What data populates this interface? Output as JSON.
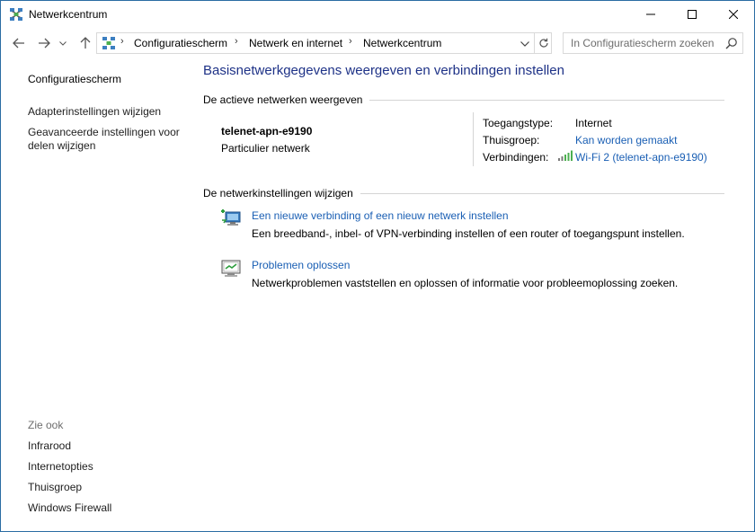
{
  "window": {
    "title": "Netwerkcentrum",
    "accent": "#2b6ca3"
  },
  "navigation": {
    "breadcrumbs": [
      "Configuratiescherm",
      "Netwerk en internet",
      "Netwerkcentrum"
    ],
    "search_placeholder": "In Configuratiescherm zoeken"
  },
  "sidebar": {
    "home": "Configuratiescherm",
    "links": [
      "Adapterinstellingen wijzigen",
      "Geavanceerde instellingen voor",
      "delen wijzigen"
    ],
    "see_also_heading": "Zie ook",
    "see_also": [
      "Infrarood",
      "Internetopties",
      "Thuisgroep",
      "Windows Firewall"
    ]
  },
  "main": {
    "title": "Basisnetwerkgegevens weergeven en verbindingen instellen",
    "active_networks_heading": "De actieve netwerken weergeven",
    "network": {
      "name": "telenet-apn-e9190",
      "type": "Particulier netwerk",
      "access_type_label": "Toegangstype:",
      "access_type_value": "Internet",
      "homegroup_label": "Thuisgroep:",
      "homegroup_value": "Kan worden gemaakt",
      "connections_label": "Verbindingen:",
      "connections_value": "Wi-Fi 2 (telenet-apn-e9190)"
    },
    "change_settings_heading": "De netwerkinstellingen wijzigen",
    "tasks": [
      {
        "link": "Een nieuwe verbinding of een nieuw netwerk instellen",
        "description": "Een breedband-, inbel- of VPN-verbinding instellen of een router of toegangspunt instellen.",
        "icon": "new-connection-icon"
      },
      {
        "link": "Problemen oplossen",
        "description": "Netwerkproblemen vaststellen en oplossen of informatie voor probleemoplossing zoeken.",
        "icon": "troubleshoot-icon"
      }
    ],
    "link_color": "#1a5fb4",
    "title_color": "#1e3287"
  }
}
